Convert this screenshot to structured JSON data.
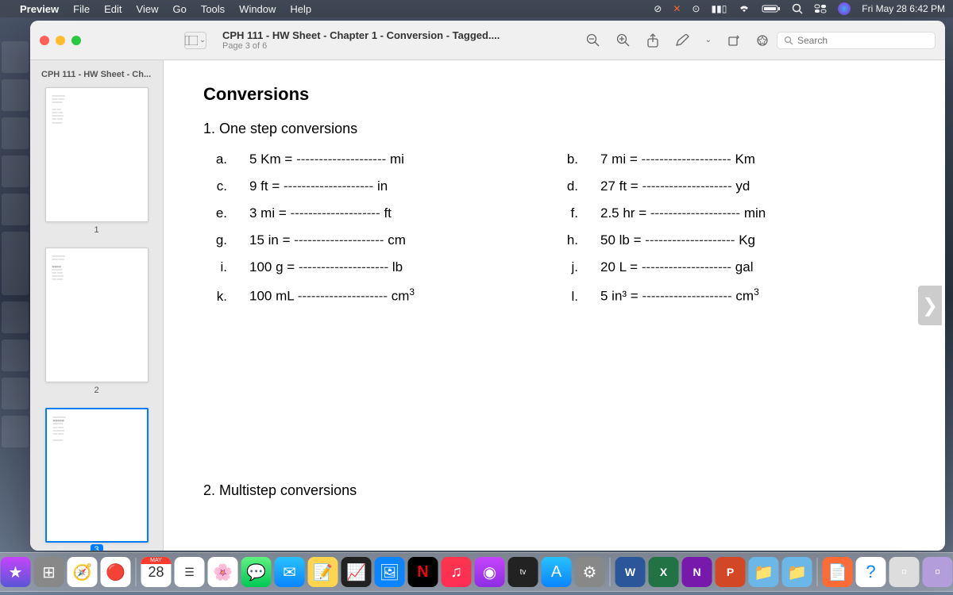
{
  "menubar": {
    "app": "Preview",
    "items": [
      "File",
      "Edit",
      "View",
      "Go",
      "Tools",
      "Window",
      "Help"
    ],
    "clock": "Fri May 28  6:42 PM"
  },
  "window": {
    "doc_title": "CPH 111 - HW Sheet - Chapter 1 - Conversion - Tagged....",
    "page_info": "Page 3 of 6",
    "search_placeholder": "Search",
    "sidebar_title": "CPH 111 - HW Sheet - Ch..."
  },
  "thumbs": [
    "1",
    "2",
    "3"
  ],
  "doc": {
    "h1": "Conversions",
    "h2a": "1. One step conversions",
    "h2b": "2. Multistep conversions",
    "rows": [
      {
        "la": "a.",
        "ea": "5 Km = ",
        "ua": "mi",
        "lb": "b.",
        "eb": "7 mi = ",
        "ub": "Km"
      },
      {
        "la": "c.",
        "ea": "9 ft = ",
        "ua": "in",
        "lb": "d.",
        "eb": "27 ft = ",
        "ub": "yd"
      },
      {
        "la": "e.",
        "ea": "3 mi = ",
        "ua": "ft",
        "lb": "f.",
        "eb": "2.5 hr = ",
        "ub": "min"
      },
      {
        "la": "g.",
        "ea": "15 in = ",
        "ua": "cm",
        "lb": "h.",
        "eb": "50 lb = ",
        "ub": "Kg"
      },
      {
        "la": "i.",
        "ea": "100 g = ",
        "ua": "lb",
        "lb": "j.",
        "eb": "20 L = ",
        "ub": "gal"
      },
      {
        "la": "k.",
        "ea": "100 mL ",
        "ua": "cm³",
        "lb": "l.",
        "eb": "5 in³ = ",
        "ub": "cm³"
      }
    ]
  },
  "calendar": {
    "month": "MAY",
    "day": "28"
  }
}
